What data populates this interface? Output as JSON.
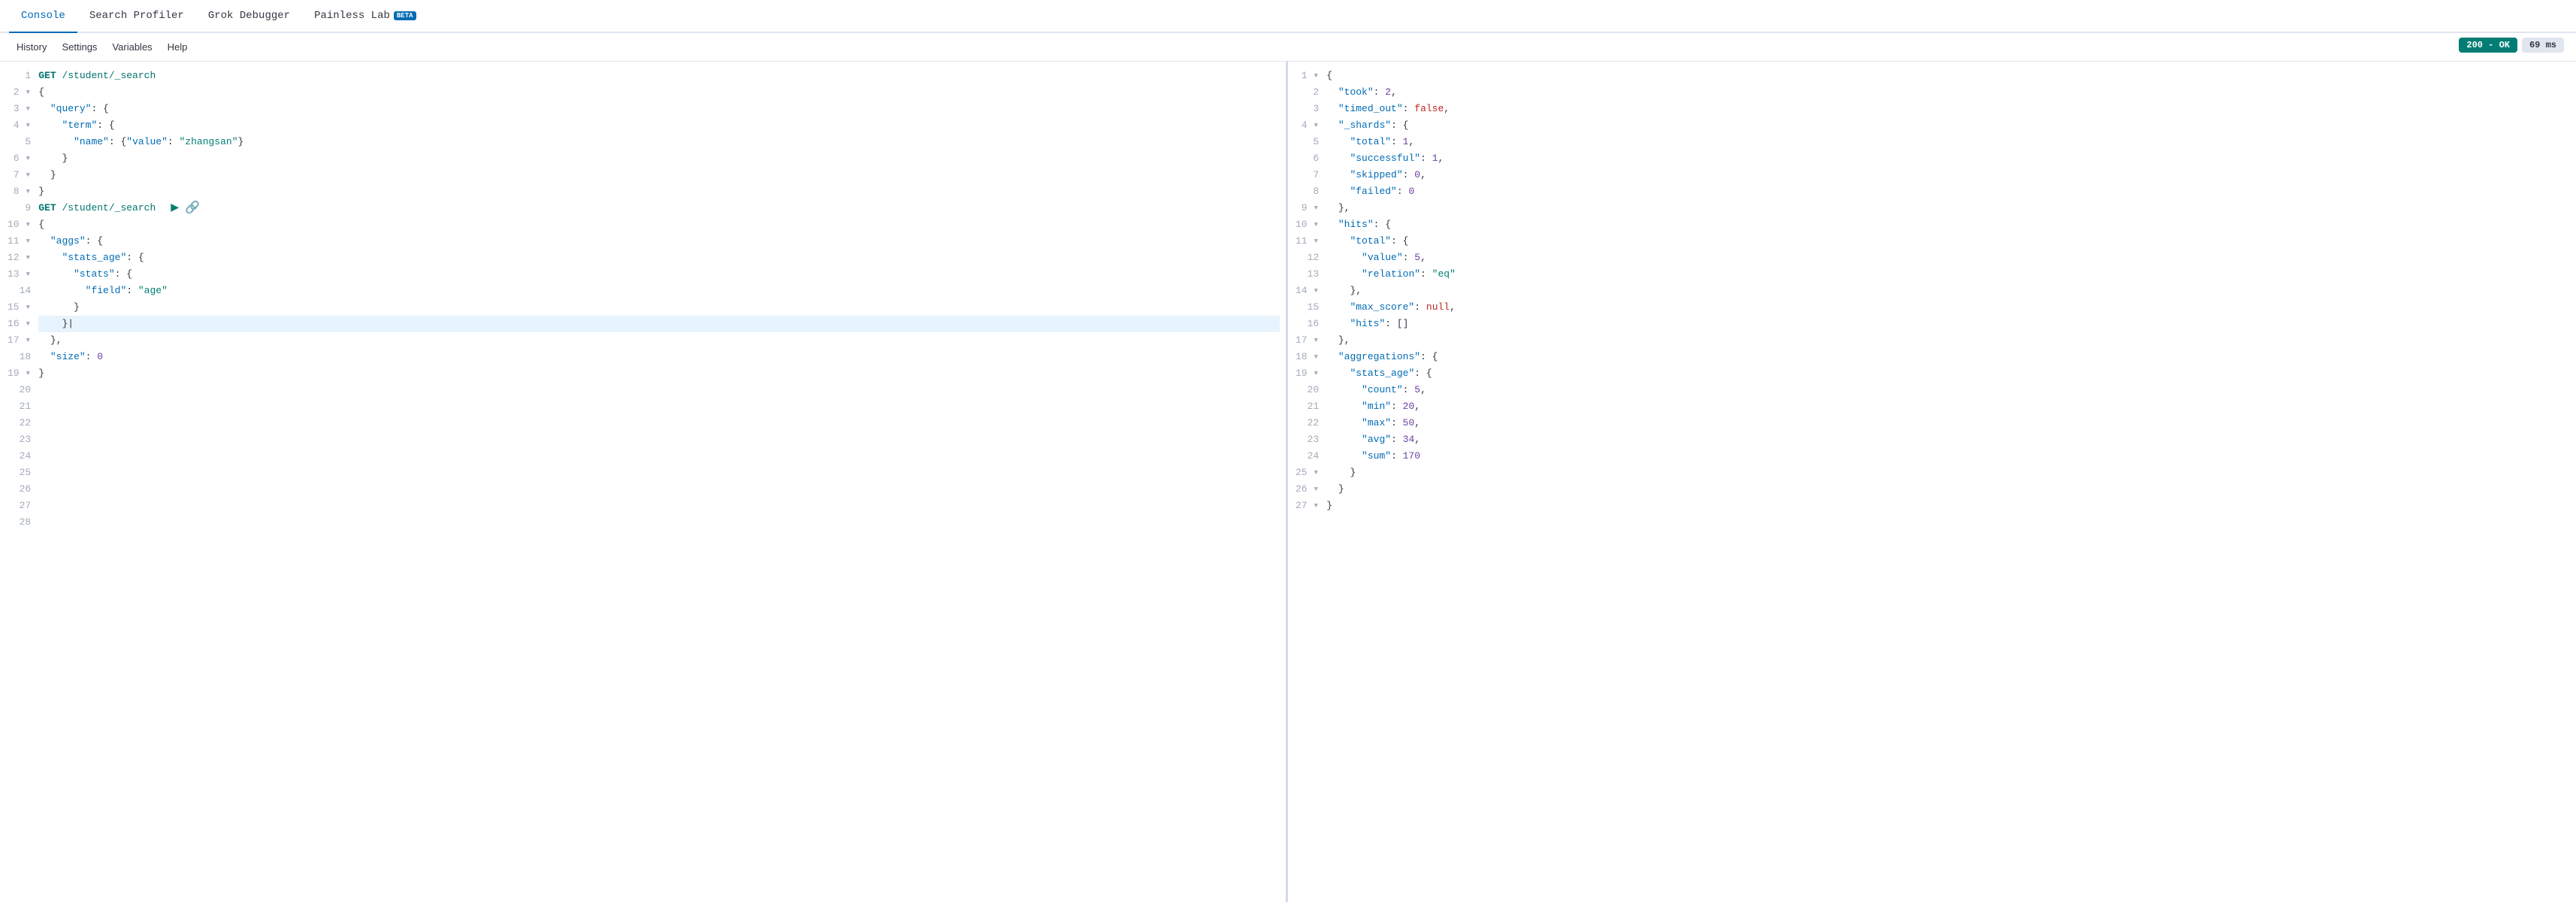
{
  "tabs": [
    {
      "id": "console",
      "label": "Console",
      "active": true,
      "beta": false
    },
    {
      "id": "search-profiler",
      "label": "Search Profiler",
      "active": false,
      "beta": false
    },
    {
      "id": "grok-debugger",
      "label": "Grok Debugger",
      "active": false,
      "beta": false
    },
    {
      "id": "painless-lab",
      "label": "Painless Lab",
      "active": false,
      "beta": true
    }
  ],
  "toolbar": {
    "items": [
      "History",
      "Settings",
      "Variables",
      "Help"
    ]
  },
  "status": {
    "code": "200 - OK",
    "time": "69 ms"
  },
  "editor": {
    "lines": [
      {
        "num": 1,
        "fold": false,
        "content": "GET /student/_search",
        "type": "method_url"
      },
      {
        "num": 2,
        "fold": true,
        "content": "{",
        "type": "punct"
      },
      {
        "num": 3,
        "fold": true,
        "content": "  \"query\": {",
        "type": "key_open"
      },
      {
        "num": 4,
        "fold": true,
        "content": "    \"term\": {",
        "type": "key_open"
      },
      {
        "num": 5,
        "fold": false,
        "content": "      \"name\": {\"value\": \"zhangsan\"}",
        "type": "mixed"
      },
      {
        "num": 6,
        "fold": true,
        "content": "    }",
        "type": "close"
      },
      {
        "num": 7,
        "fold": true,
        "content": "  }",
        "type": "close"
      },
      {
        "num": 8,
        "fold": true,
        "content": "}",
        "type": "close"
      },
      {
        "num": 9,
        "fold": false,
        "content": "GET /student/_search",
        "type": "method_url",
        "hasActions": true
      },
      {
        "num": 10,
        "fold": true,
        "content": "{",
        "type": "punct"
      },
      {
        "num": 11,
        "fold": true,
        "content": "  \"aggs\": {",
        "type": "key_open"
      },
      {
        "num": 12,
        "fold": true,
        "content": "    \"stats_age\": {",
        "type": "key_open"
      },
      {
        "num": 13,
        "fold": true,
        "content": "      \"stats\": {",
        "type": "key_open"
      },
      {
        "num": 14,
        "fold": false,
        "content": "        \"field\": \"age\"",
        "type": "key_val"
      },
      {
        "num": 15,
        "fold": true,
        "content": "      }",
        "type": "close"
      },
      {
        "num": 16,
        "fold": true,
        "content": "    }",
        "type": "close",
        "highlighted": true
      },
      {
        "num": 17,
        "fold": true,
        "content": "  },",
        "type": "close"
      },
      {
        "num": 18,
        "fold": false,
        "content": "  \"size\": 0",
        "type": "key_num"
      },
      {
        "num": 19,
        "fold": true,
        "content": "}",
        "type": "close"
      },
      {
        "num": 20,
        "fold": false,
        "content": "",
        "type": "empty"
      },
      {
        "num": 21,
        "fold": false,
        "content": "",
        "type": "empty"
      },
      {
        "num": 22,
        "fold": false,
        "content": "",
        "type": "empty"
      },
      {
        "num": 23,
        "fold": false,
        "content": "",
        "type": "empty"
      },
      {
        "num": 24,
        "fold": false,
        "content": "",
        "type": "empty"
      },
      {
        "num": 25,
        "fold": false,
        "content": "",
        "type": "empty"
      },
      {
        "num": 26,
        "fold": false,
        "content": "",
        "type": "empty"
      },
      {
        "num": 27,
        "fold": false,
        "content": "",
        "type": "empty"
      },
      {
        "num": 28,
        "fold": false,
        "content": "",
        "type": "empty"
      }
    ]
  },
  "output": {
    "lines": [
      {
        "num": 1,
        "fold": true,
        "raw": "{"
      },
      {
        "num": 2,
        "fold": false,
        "raw": "  \"took\": 2,"
      },
      {
        "num": 3,
        "fold": false,
        "raw": "  \"timed_out\": false,"
      },
      {
        "num": 4,
        "fold": true,
        "raw": "  \"_shards\": {"
      },
      {
        "num": 5,
        "fold": false,
        "raw": "    \"total\": 1,"
      },
      {
        "num": 6,
        "fold": false,
        "raw": "    \"successful\": 1,"
      },
      {
        "num": 7,
        "fold": false,
        "raw": "    \"skipped\": 0,"
      },
      {
        "num": 8,
        "fold": false,
        "raw": "    \"failed\": 0"
      },
      {
        "num": 9,
        "fold": true,
        "raw": "  },"
      },
      {
        "num": 10,
        "fold": true,
        "raw": "  \"hits\": {"
      },
      {
        "num": 11,
        "fold": true,
        "raw": "    \"total\": {"
      },
      {
        "num": 12,
        "fold": false,
        "raw": "      \"value\": 5,"
      },
      {
        "num": 13,
        "fold": false,
        "raw": "      \"relation\": \"eq\""
      },
      {
        "num": 14,
        "fold": true,
        "raw": "    },"
      },
      {
        "num": 15,
        "fold": false,
        "raw": "    \"max_score\": null,"
      },
      {
        "num": 16,
        "fold": false,
        "raw": "    \"hits\": []"
      },
      {
        "num": 17,
        "fold": true,
        "raw": "  },"
      },
      {
        "num": 18,
        "fold": true,
        "raw": "  \"aggregations\": {"
      },
      {
        "num": 19,
        "fold": true,
        "raw": "    \"stats_age\": {"
      },
      {
        "num": 20,
        "fold": false,
        "raw": "      \"count\": 5,"
      },
      {
        "num": 21,
        "fold": false,
        "raw": "      \"min\": 20,"
      },
      {
        "num": 22,
        "fold": false,
        "raw": "      \"max\": 50,"
      },
      {
        "num": 23,
        "fold": false,
        "raw": "      \"avg\": 34,"
      },
      {
        "num": 24,
        "fold": false,
        "raw": "      \"sum\": 170"
      },
      {
        "num": 25,
        "fold": true,
        "raw": "    }"
      },
      {
        "num": 26,
        "fold": true,
        "raw": "  }"
      },
      {
        "num": 27,
        "fold": true,
        "raw": "}"
      }
    ]
  }
}
